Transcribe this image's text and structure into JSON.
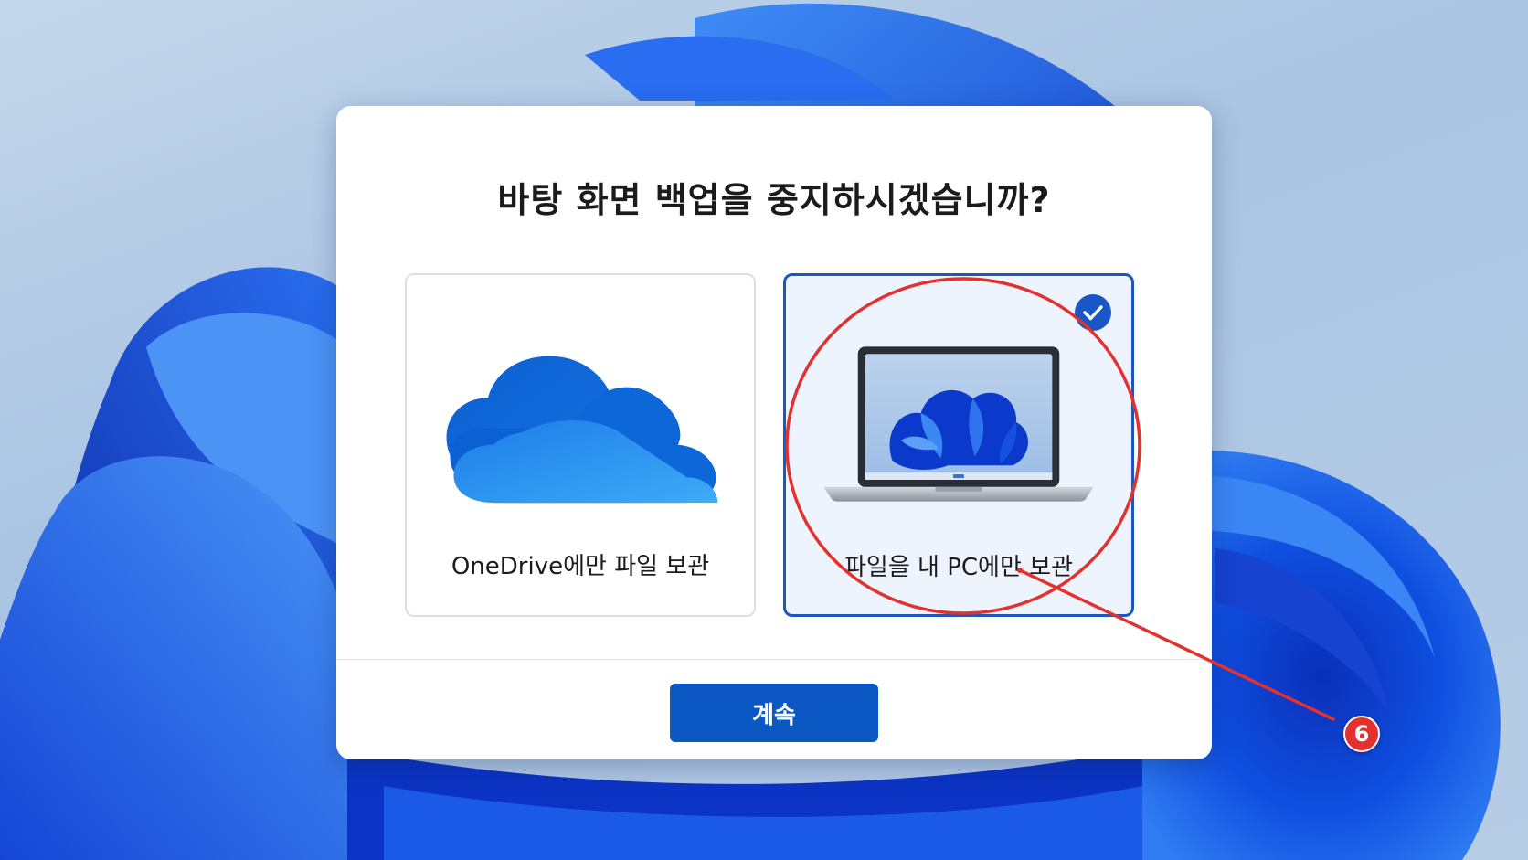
{
  "dialog": {
    "title": "바탕 화면 백업을 중지하시겠습니까?",
    "options": [
      {
        "label": "OneDrive에만 파일 보관",
        "icon": "onedrive-cloud-icon",
        "selected": false
      },
      {
        "label": "파일을 내 PC에만 보관",
        "icon": "laptop-icon",
        "selected": true
      }
    ],
    "continue_label": "계속"
  },
  "annotation": {
    "step_number": "6",
    "color": "#e2312e"
  },
  "colors": {
    "accent": "#0b58c4",
    "selected_border": "#1b57bd",
    "selected_background": "#eef4fd"
  }
}
